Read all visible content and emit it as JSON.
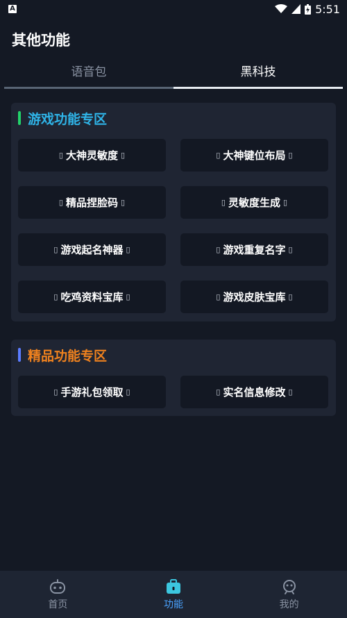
{
  "status_bar": {
    "time": "5:51",
    "app_icon_letter": "A",
    "icons": [
      "wifi-icon",
      "cell-signal-icon",
      "battery-icon"
    ]
  },
  "header": {
    "title": "其他功能"
  },
  "tabs": [
    {
      "label": "语音包",
      "active": false
    },
    {
      "label": "黑科技",
      "active": true
    }
  ],
  "sections": [
    {
      "title": "游戏功能专区",
      "accent_color": "#22d36a",
      "title_color": "#2fb4e8",
      "buttons": [
        "大神灵敏度",
        "大神键位布局",
        "精品捏脸码",
        "灵敏度生成",
        "游戏起名神器",
        "游戏重复名字",
        "吃鸡资料宝库",
        "游戏皮肤宝库"
      ]
    },
    {
      "title": "精品功能专区",
      "accent_color": "#5b7cff",
      "title_color": "#f0821e",
      "buttons": [
        "手游礼包领取",
        "实名信息修改"
      ]
    }
  ],
  "button_glyph": "▯",
  "bottom_nav": [
    {
      "label": "首页",
      "icon": "gamepad-icon",
      "active": false
    },
    {
      "label": "功能",
      "icon": "toolbox-icon",
      "active": true
    },
    {
      "label": "我的",
      "icon": "robot-face-icon",
      "active": false
    }
  ],
  "colors": {
    "background": "#141924",
    "card": "#1f2533",
    "button": "#131823",
    "nav_active": "#4aa3ff",
    "nav_inactive": "#8a93a3"
  }
}
